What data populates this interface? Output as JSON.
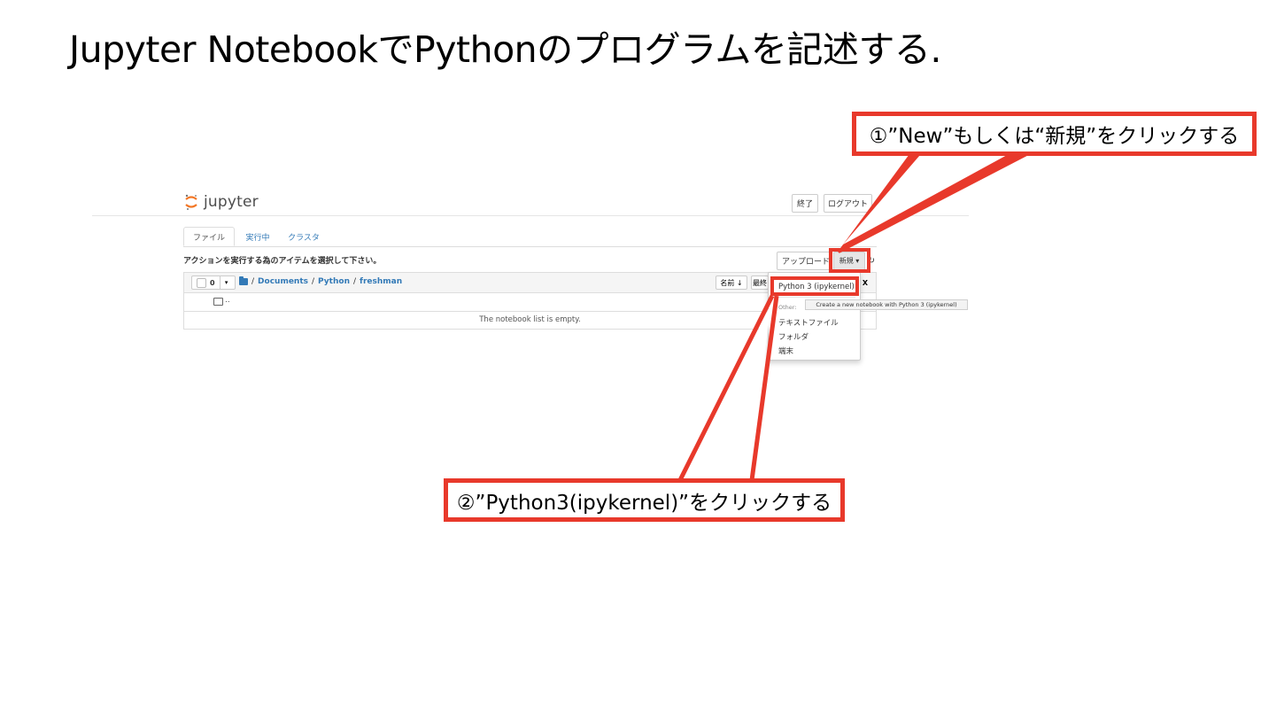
{
  "slide": {
    "title": "Jupyter NotebookでPythonのプログラムを記述する."
  },
  "jupyter": {
    "logo_text": "jupyter",
    "header_buttons": {
      "quit": "終了",
      "logout": "ログアウト"
    },
    "tabs": [
      {
        "label": "ファイル",
        "active": true
      },
      {
        "label": "実行中",
        "active": false
      },
      {
        "label": "クラスタ",
        "active": false
      }
    ],
    "instruction": "アクションを実行する為のアイテムを選択して下さい。",
    "toolbar": {
      "upload": "アップロード",
      "new": "新規 ▾",
      "refresh_icon": "refresh-icon"
    },
    "list_header": {
      "selected_count": "0",
      "breadcrumb": [
        "Documents",
        "Python",
        "freshman"
      ],
      "sort_name": "名前 ↓",
      "sort_modified": "最終",
      "close_glyph": "X"
    },
    "updir_label": "..",
    "empty_message": "The notebook list is empty.",
    "new_menu": {
      "kernel_item": "Python 3 (ipykernel)",
      "other_header": "Other:",
      "items": [
        "テキストファイル",
        "フォルダ",
        "端末"
      ]
    },
    "tooltip": "Create a new notebook with Python 3 (ipykernel)"
  },
  "annotations": {
    "step1": "①”New”もしくは“新規”をクリックする",
    "step2": "②”Python3(ipykernel)”をクリックする",
    "color": "#e8392b"
  }
}
